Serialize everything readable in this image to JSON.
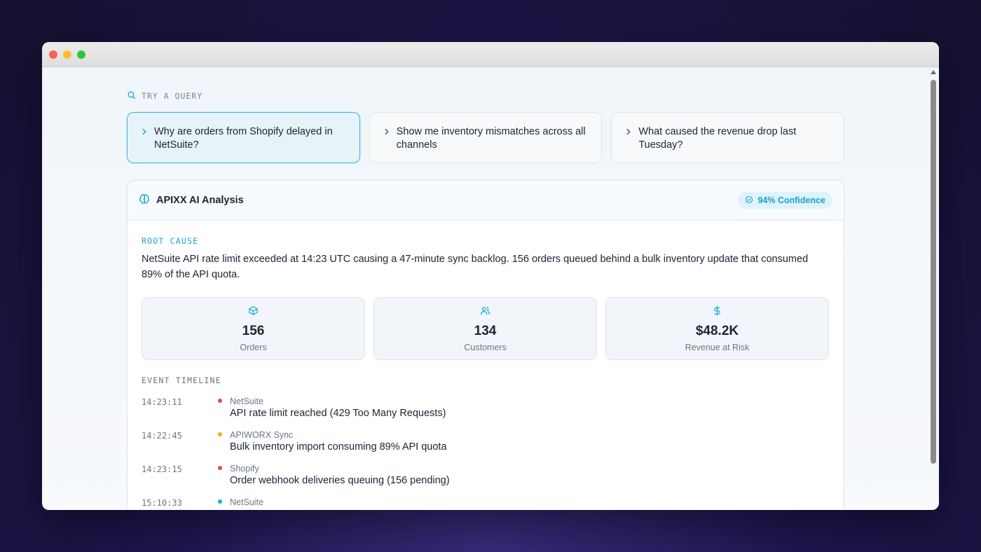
{
  "window": {
    "controls": [
      "close",
      "minimize",
      "maximize"
    ]
  },
  "query_section": {
    "label": "TRY A QUERY",
    "icon": "search-icon",
    "queries": [
      {
        "text": "Why are orders from Shopify delayed in NetSuite?",
        "active": true
      },
      {
        "text": "Show me inventory mismatches across all channels",
        "active": false
      },
      {
        "text": "What caused the revenue drop last Tuesday?",
        "active": false
      }
    ]
  },
  "analysis": {
    "title": "APIXX AI Analysis",
    "icon": "brain-icon",
    "confidence": "94% Confidence",
    "root_cause_label": "ROOT CAUSE",
    "root_cause_text": "NetSuite API rate limit exceeded at 14:23 UTC causing a 47-minute sync backlog. 156 orders queued behind a bulk inventory update that consumed 89% of the API quota.",
    "metrics": [
      {
        "icon": "box-icon",
        "value": "156",
        "label": "Orders"
      },
      {
        "icon": "users-icon",
        "value": "134",
        "label": "Customers"
      },
      {
        "icon": "dollar-icon",
        "value": "$48.2K",
        "label": "Revenue at Risk"
      }
    ],
    "timeline_label": "EVENT TIMELINE",
    "events": [
      {
        "time": "14:23:11",
        "source": "NetSuite",
        "message": "API rate limit reached (429 Too Many Requests)",
        "color": "#ef4444"
      },
      {
        "time": "14:22:45",
        "source": "APIWORX Sync",
        "message": "Bulk inventory import consuming 89% API quota",
        "color": "#eab308"
      },
      {
        "time": "14:23:15",
        "source": "Shopify",
        "message": "Order webhook deliveries queuing (156 pending)",
        "color": "#ef4444"
      },
      {
        "time": "15:10:33",
        "source": "NetSuite",
        "message": "",
        "color": "#06b6d4"
      }
    ]
  },
  "colors": {
    "accent": "#19a6d0",
    "text": "#1b2434",
    "muted": "#6b7686"
  }
}
